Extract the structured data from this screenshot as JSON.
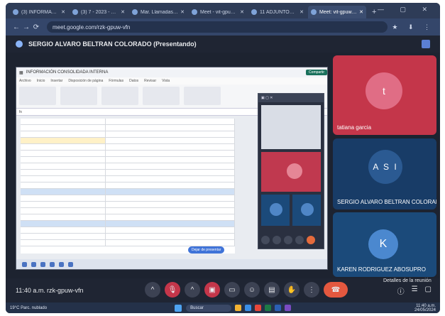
{
  "browser": {
    "tabs": [
      {
        "label": "(3) INFORMACIÓN CONSO...",
        "active": false
      },
      {
        "label": "(3) 7 - 2023 - Google D...",
        "active": false
      },
      {
        "label": "Mar. Llamadas interna...",
        "active": false
      },
      {
        "label": "Meet - vit-gpuw-vfn",
        "active": false
      },
      {
        "label": "11 ADJUNTOS - Google...",
        "active": false
      },
      {
        "label": "Meet: vit-gpuw-vfn",
        "active": true
      }
    ],
    "new_tab": "+",
    "url": "meet.google.com/rzk-gpuw-vfn"
  },
  "meet": {
    "presenter_banner": "SERGIO ALVARO BELTRAN COLORADO (Presentando)",
    "participants": [
      {
        "name": "tatiana garcia",
        "initial": "t",
        "color": "#c4364a"
      },
      {
        "name": "SERGIO ALVARO BELTRAN COLORADO",
        "initial": "A S I",
        "color": "#183c67"
      },
      {
        "name": "KAREN RODRIGUEZ ABOSUPRO",
        "initial": "K",
        "color": "#1b4a7a"
      }
    ],
    "time": "11:40 a.m.",
    "meeting_code": "rzk-gpuw-vfn",
    "details_label": "Detalles de la reunión"
  },
  "shared_screen": {
    "doc_title": "INFORMACIÓN CONSOLIDADA INTERNA",
    "top_button": "Compartir",
    "menu": [
      "Archivo",
      "Inicio",
      "Insertar",
      "Disposición de página",
      "Fórmulas",
      "Datos",
      "Revisar",
      "Vista"
    ],
    "pill_label": "Dejar de presentar"
  },
  "taskbar": {
    "weather": "19°C\nParc. nublado",
    "search_placeholder": "Buscar",
    "tray_time": "11:40 a.m.",
    "tray_date": "24/05/2024"
  }
}
